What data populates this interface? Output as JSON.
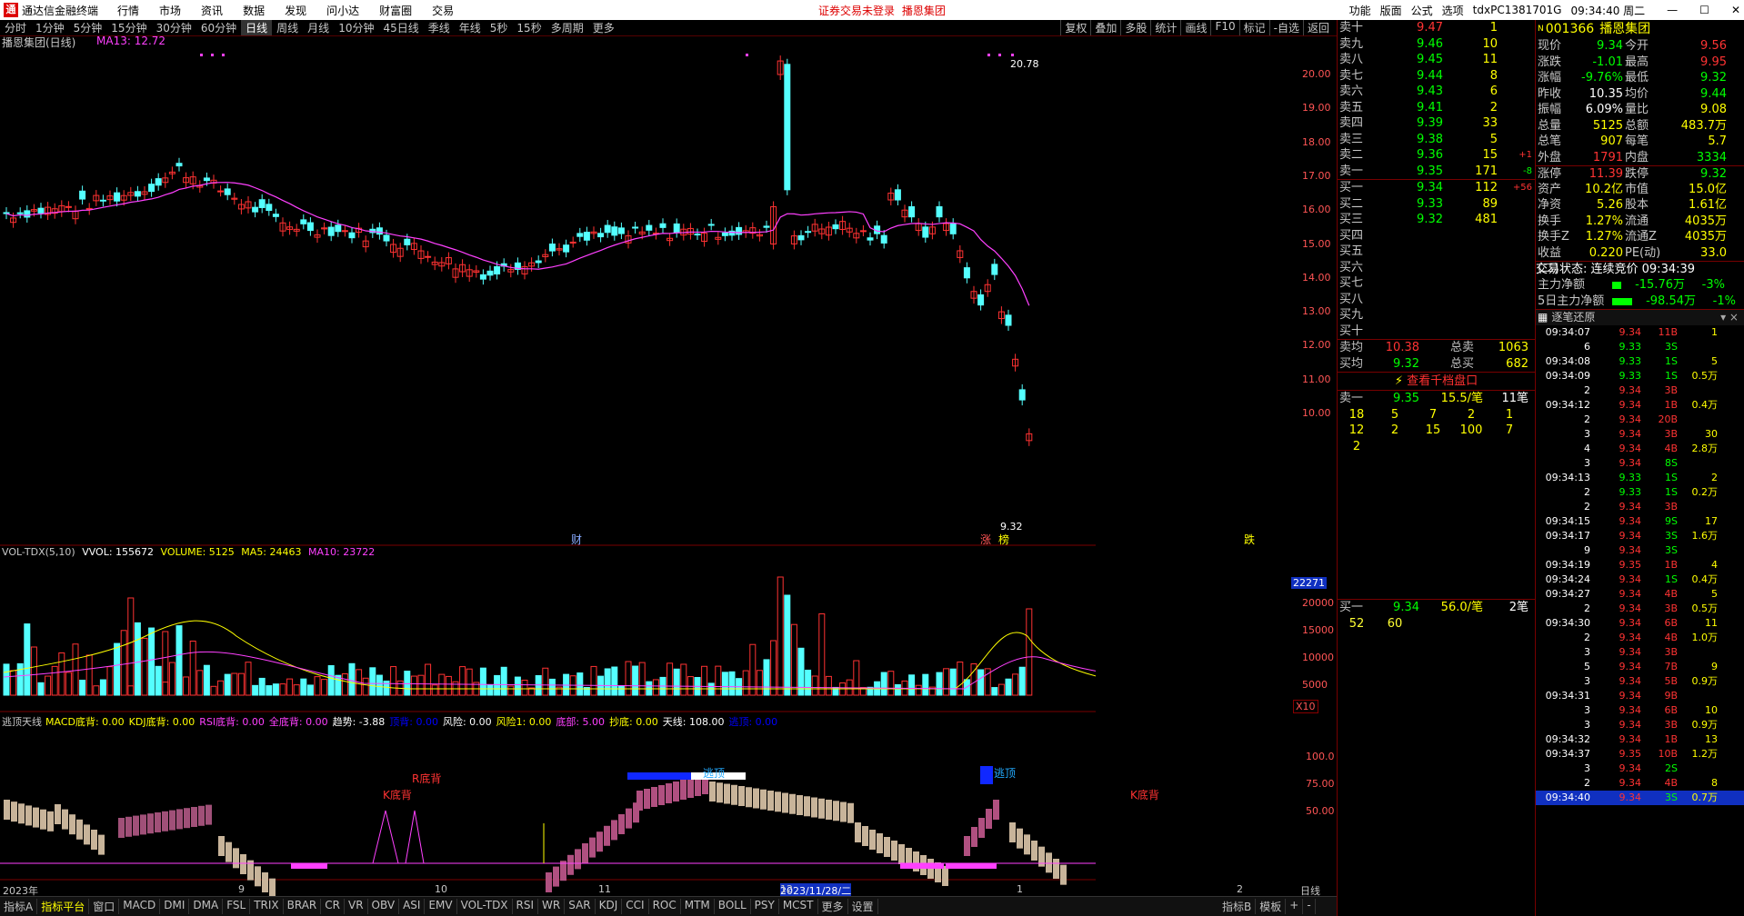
{
  "titlebar": {
    "logo": "通",
    "app": "通达信金融终端",
    "menu": [
      "行情",
      "市场",
      "资讯",
      "数据",
      "发现",
      "问小达",
      "财富圈",
      "交易"
    ],
    "notice": "证券交易未登录",
    "notice_stock": "播恩集团",
    "right": [
      "功能",
      "版面",
      "公式",
      "选项",
      "tdxPC1381701G",
      "09:34:40 周二"
    ]
  },
  "periods": [
    "分时",
    "1分钟",
    "5分钟",
    "15分钟",
    "30分钟",
    "60分钟",
    "日线",
    "周线",
    "月线",
    "10分钟",
    "45日线",
    "季线",
    "年线",
    "5秒",
    "15秒",
    "多周期",
    "更多"
  ],
  "active_period": "日线",
  "top_right_tools": [
    "复权",
    "叠加",
    "多股",
    "统计",
    "画线",
    "F10",
    "标记",
    "-自选",
    "返回"
  ],
  "main_chart": {
    "name": "播恩集团(日线)",
    "ma_label": "MA13: 12.72",
    "y_ticks": [
      "20.00",
      "19.00",
      "18.00",
      "17.00",
      "16.00",
      "15.00",
      "14.00",
      "13.00",
      "12.00",
      "11.00",
      "10.00"
    ],
    "high_label": "20.78",
    "low_label": "9.32",
    "markers": [
      "财",
      "涨",
      "榜",
      "跌"
    ]
  },
  "vol_chart": {
    "title": "VOL-TDX(5,10)",
    "vvol": "VVOL: 155672",
    "volume": "VOLUME: 5125",
    "ma5": "MA5: 24463",
    "ma10": "MA10: 23722",
    "y_ticks": [
      "20000",
      "15000",
      "10000",
      "5000"
    ],
    "cur": "22271",
    "unit": "X10"
  },
  "ind_chart": {
    "title": "逃顶天线",
    "items": [
      "MACD底背: 0.00",
      "KDJ底背: 0.00",
      "RSI底背: 0.00",
      "全底背: 0.00",
      "趋势: -3.88",
      "顶背: 0.00",
      "风险: 0.00",
      "风险1: 0.00",
      "底部: 5.00",
      "抄底: 0.00",
      "天线: 108.00",
      "逃顶: 0.00"
    ],
    "y_ticks": [
      "100.0",
      "75.00",
      "50.00"
    ],
    "labels": [
      "R底背",
      "K底背",
      "逃顶",
      "逃顶",
      "K底背"
    ]
  },
  "x_axis": {
    "labels": [
      "2023年",
      "9",
      "10",
      "11",
      "2023/11/28/二",
      "12",
      "1",
      "2"
    ],
    "right": "日线"
  },
  "bottom_tabs": [
    "指标A",
    "指标平台",
    "窗口",
    "MACD",
    "DMI",
    "DMA",
    "FSL",
    "TRIX",
    "BRAR",
    "CR",
    "VR",
    "OBV",
    "ASI",
    "EMV",
    "VOL-TDX",
    "RSI",
    "WR",
    "SAR",
    "KDJ",
    "CCI",
    "ROC",
    "MTM",
    "BOLL",
    "PSY",
    "MCST",
    "更多",
    "设置"
  ],
  "bottom_right": [
    "指标B",
    "模板",
    "+",
    "-"
  ],
  "orderbook": {
    "sells": [
      [
        "卖十",
        "9.47",
        "1"
      ],
      [
        "卖九",
        "9.46",
        "10"
      ],
      [
        "卖八",
        "9.45",
        "11"
      ],
      [
        "卖七",
        "9.44",
        "8"
      ],
      [
        "卖六",
        "9.43",
        "6"
      ],
      [
        "卖五",
        "9.41",
        "2"
      ],
      [
        "卖四",
        "9.39",
        "33"
      ],
      [
        "卖三",
        "9.38",
        "5"
      ],
      [
        "卖二",
        "9.36",
        "15"
      ],
      [
        "卖一",
        "9.35",
        "171"
      ]
    ],
    "sell_changes": [
      "",
      "",
      "",
      "",
      "",
      "",
      "",
      "",
      "+1",
      "-8"
    ],
    "buys": [
      [
        "买一",
        "9.34",
        "112"
      ],
      [
        "买二",
        "9.33",
        "89"
      ],
      [
        "买三",
        "9.32",
        "481"
      ],
      [
        "买四",
        "",
        ""
      ],
      [
        "买五",
        "",
        ""
      ],
      [
        "买六",
        "",
        ""
      ],
      [
        "买七",
        "",
        ""
      ],
      [
        "买八",
        "",
        ""
      ],
      [
        "买九",
        "",
        ""
      ],
      [
        "买十",
        "",
        ""
      ]
    ],
    "buy_changes": [
      "+56",
      "",
      ""
    ],
    "avg": [
      [
        "卖均",
        "10.38",
        "总卖",
        "1063"
      ],
      [
        "买均",
        "9.32",
        "总买",
        "682"
      ]
    ],
    "link": "查看千档盘口",
    "sell1": [
      "卖一",
      "9.35",
      "15.5/笔",
      "11笔"
    ],
    "sell1_rows": [
      [
        "18",
        "5",
        "7",
        "2",
        "1"
      ],
      [
        "12",
        "2",
        "15",
        "100",
        "7"
      ],
      [
        "2",
        "",
        "",
        "",
        ""
      ]
    ],
    "buy1": [
      "买一",
      "9.34",
      "56.0/笔",
      "2笔"
    ],
    "buy1_rows": [
      [
        "52",
        "60"
      ]
    ]
  },
  "quote": {
    "code": "001366",
    "name": "播恩集团",
    "rows": [
      [
        "现价",
        "9.34",
        "今开",
        "9.56"
      ],
      [
        "涨跌",
        "-1.01",
        "最高",
        "9.95"
      ],
      [
        "涨幅",
        "-9.76%",
        "最低",
        "9.32"
      ],
      [
        "昨收",
        "10.35",
        "均价",
        "9.44"
      ],
      [
        "振幅",
        "6.09%",
        "量比",
        "9.08"
      ],
      [
        "总量",
        "5125",
        "总额",
        "483.7万"
      ],
      [
        "总笔",
        "907",
        "每笔",
        "5.7"
      ],
      [
        "外盘",
        "1791",
        "内盘",
        "3334"
      ],
      [
        "涨停",
        "11.39",
        "跌停",
        "9.32"
      ],
      [
        "资产",
        "10.2亿",
        "市值",
        "15.0亿"
      ],
      [
        "净资",
        "5.26",
        "股本",
        "1.61亿"
      ],
      [
        "换手",
        "1.27%",
        "流通",
        "4035万"
      ],
      [
        "换手Z",
        "1.27%",
        "流通Z",
        "4035万"
      ],
      [
        "收益(二)",
        "0.220",
        "PE(动)",
        "33.0"
      ]
    ],
    "status": "交易状态: 连续竞价 09:34:39",
    "funds": [
      [
        "主力净额",
        "-15.76万",
        "-3%"
      ],
      [
        "5日主力净额",
        "-98.54万",
        "-1%"
      ]
    ],
    "ticks_title": "逐笔还原",
    "ticks": [
      [
        "09:34:07",
        "9.34",
        "11B",
        "1"
      ],
      [
        "6",
        "9.33",
        "3S",
        ""
      ],
      [
        "09:34:08",
        "9.33",
        "1S",
        "5"
      ],
      [
        "09:34:09",
        "9.33",
        "1S",
        "0.5万"
      ],
      [
        "2",
        "9.34",
        "3B",
        ""
      ],
      [
        "09:34:12",
        "9.34",
        "1B",
        "0.4万"
      ],
      [
        "2",
        "9.34",
        "20B",
        ""
      ],
      [
        "3",
        "9.34",
        "3B",
        "30"
      ],
      [
        "4",
        "9.34",
        "4B",
        "2.8万"
      ],
      [
        "3",
        "9.34",
        "8S",
        ""
      ],
      [
        "09:34:13",
        "9.33",
        "1S",
        "2"
      ],
      [
        "2",
        "9.33",
        "1S",
        "0.2万"
      ],
      [
        "2",
        "9.34",
        "3B",
        ""
      ],
      [
        "09:34:15",
        "9.34",
        "9S",
        "17"
      ],
      [
        "09:34:17",
        "9.34",
        "3S",
        "1.6万"
      ],
      [
        "9",
        "9.34",
        "3S",
        ""
      ],
      [
        "09:34:19",
        "9.35",
        "1B",
        "4"
      ],
      [
        "09:34:24",
        "9.34",
        "1S",
        "0.4万"
      ],
      [
        "09:34:27",
        "9.34",
        "4B",
        "5"
      ],
      [
        "2",
        "9.34",
        "3B",
        "0.5万"
      ],
      [
        "09:34:30",
        "9.34",
        "6B",
        "11"
      ],
      [
        "2",
        "9.34",
        "4B",
        "1.0万"
      ],
      [
        "3",
        "9.34",
        "3B",
        ""
      ],
      [
        "5",
        "9.34",
        "7B",
        "9"
      ],
      [
        "3",
        "9.34",
        "5B",
        "0.9万"
      ],
      [
        "09:34:31",
        "9.34",
        "9B",
        ""
      ],
      [
        "3",
        "9.34",
        "6B",
        "10"
      ],
      [
        "3",
        "9.34",
        "3B",
        "0.9万"
      ],
      [
        "09:34:32",
        "9.34",
        "1B",
        "13"
      ],
      [
        "09:34:37",
        "9.35",
        "10B",
        "1.2万"
      ],
      [
        "3",
        "9.34",
        "2S",
        ""
      ],
      [
        "2",
        "9.34",
        "4B",
        "8"
      ],
      [
        "09:34:40",
        "9.34",
        "3S",
        "0.7万"
      ]
    ]
  },
  "colors": {
    "up": "#ff3232",
    "down": "#54ffff",
    "ma": "#ff40ff",
    "bg": "#000000",
    "grid": "#7a0000"
  }
}
